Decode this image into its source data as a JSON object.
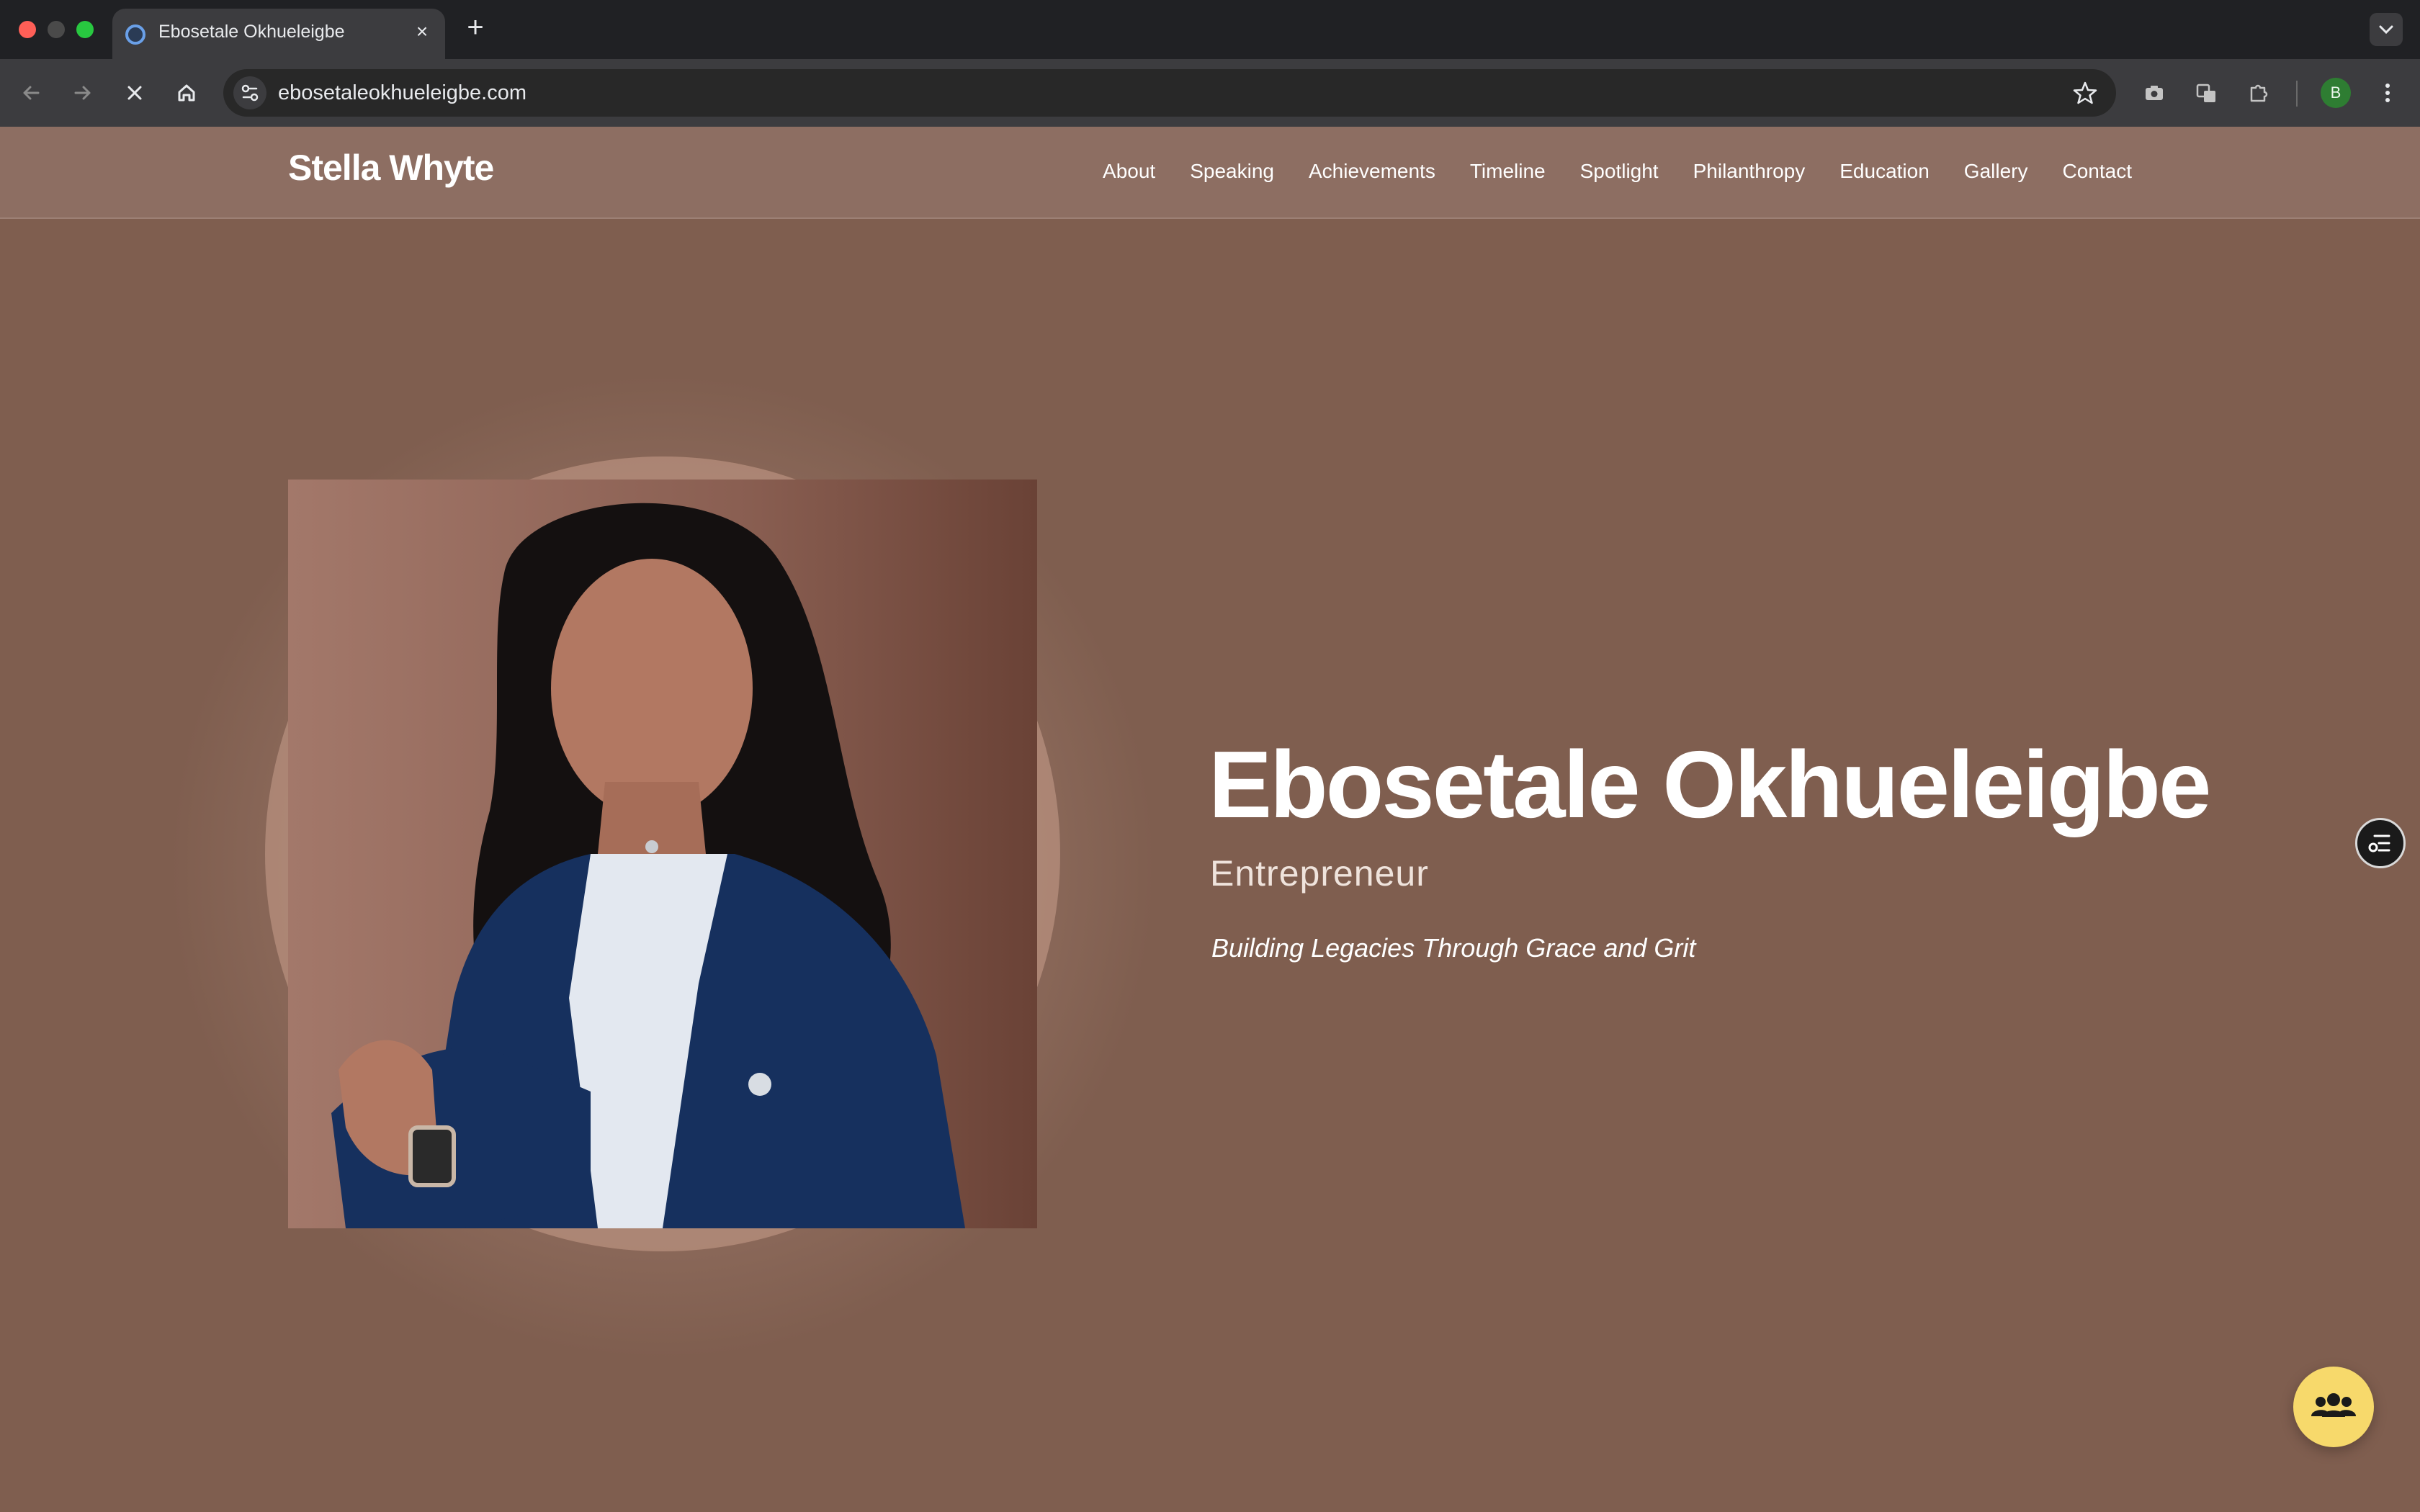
{
  "browser": {
    "tab_title": "Ebosetale Okhueleigbe",
    "tab_close_glyph": "×",
    "new_tab_glyph": "+",
    "url": "ebosetaleokhueleigbe.com",
    "profile_initial": "B",
    "icons": {
      "back": "arrow-left-icon",
      "forward": "arrow-right-icon",
      "stop": "close-icon",
      "home": "home-icon",
      "site_info": "tune-icon",
      "bookmark": "star-icon",
      "camera": "camera-icon",
      "translate": "translate-icon",
      "extensions": "puzzle-icon",
      "menu": "kebab-menu-icon"
    }
  },
  "site": {
    "brand": "Stella Whyte",
    "nav": [
      "About",
      "Speaking",
      "Achievements",
      "Timeline",
      "Spotlight",
      "Philanthropy",
      "Education",
      "Gallery",
      "Contact"
    ],
    "hero": {
      "name": "Ebosetale Okhueleigbe",
      "role": "Entrepreneur",
      "tagline": "Building Legacies Through Grace and Grit"
    },
    "colors": {
      "header_bg": "#8d6e62",
      "hero_bg": "#7f5e4f",
      "fab_bg": "#f7d96b"
    }
  }
}
